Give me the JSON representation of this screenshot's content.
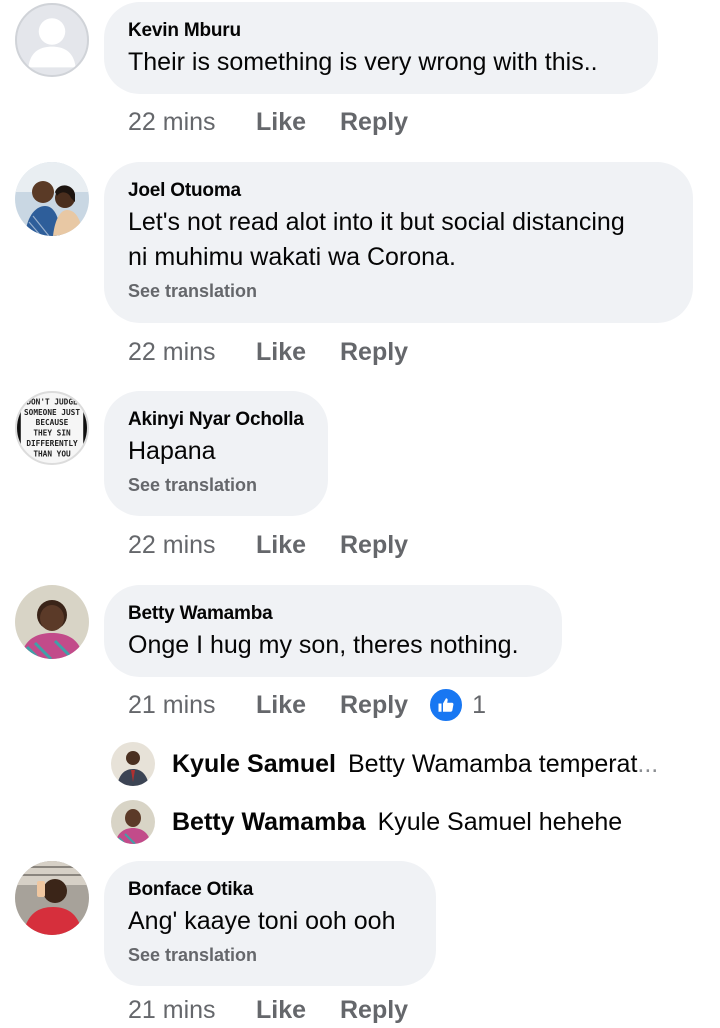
{
  "comments": [
    {
      "name": "Kevin Mburu",
      "text": "Their is something is very wrong with this..",
      "time": "22 mins",
      "like": "Like",
      "reply": "Reply"
    },
    {
      "name": "Joel Otuoma",
      "text_line1": "Let's not read alot into it but social distancing",
      "text_line2": "ni muhimu wakati wa Corona.",
      "see_translation": "See translation",
      "time": "22 mins",
      "like": "Like",
      "reply": "Reply"
    },
    {
      "name": "Akinyi Nyar Ocholla",
      "text": "Hapana",
      "see_translation": "See translation",
      "time": "22 mins",
      "like": "Like",
      "reply": "Reply",
      "avatar_text": [
        "DON'T JUDGE",
        "SOMEONE JUST",
        "BECAUSE",
        "THEY SIN",
        "DIFFERENTLY",
        "THAN YOU"
      ]
    },
    {
      "name": "Betty Wamamba",
      "text": "Onge I hug my son, theres nothing.",
      "time": "21 mins",
      "like": "Like",
      "reply": "Reply",
      "reaction_count": "1",
      "reaction_icon": "thumbs-up-icon"
    },
    {
      "name": "Bonface Otika",
      "text": "Ang' kaaye toni ooh ooh",
      "see_translation": "See translation",
      "time": "21 mins",
      "like": "Like",
      "reply": "Reply"
    }
  ],
  "replies": [
    {
      "name": "Kyule Samuel",
      "text": "Betty Wamamba temperat",
      "ellipsis": "..."
    },
    {
      "name": "Betty Wamamba",
      "text": "Kyule Samuel hehehe"
    }
  ],
  "colors": {
    "bubble": "#f0f2f5",
    "secondary_text": "#65676b",
    "like_blue": "#1877f2"
  }
}
